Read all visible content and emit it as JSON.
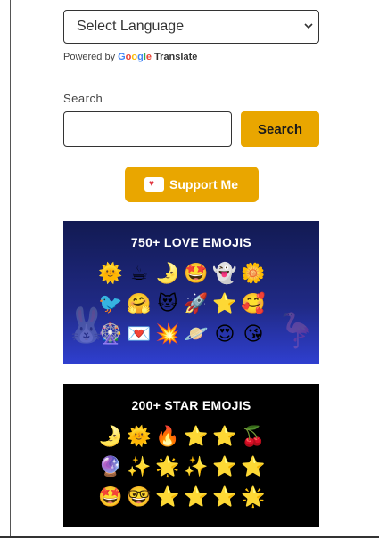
{
  "language_select": {
    "selected": "Select Language"
  },
  "powered_by": {
    "prefix": "Powered by",
    "brand": "Google",
    "product": "Translate"
  },
  "search": {
    "label": "Search",
    "button": "Search",
    "value": ""
  },
  "support": {
    "label": "Support Me",
    "icon": "ko-fi-cup-icon"
  },
  "banners": [
    {
      "title": "750+ LOVE EMOJIS",
      "emojis": [
        "🌞",
        "☕",
        "🌛",
        "🤩",
        "👻",
        "🌼",
        "🐦",
        "🤗",
        "😻",
        "🚀",
        "⭐",
        "🥰",
        "🎡",
        "💌",
        "💥",
        "🪐",
        "😍",
        "😘"
      ]
    },
    {
      "title": "200+ STAR EMOJIS",
      "emojis": [
        "🌛",
        "🌞",
        "🔥",
        "⭐",
        "⭐",
        "🍒",
        "🔮",
        "✨",
        "🌟",
        "✨",
        "⭐",
        "⭐",
        "🤩",
        "🤓",
        "⭐",
        "⭐",
        "⭐",
        "🌟"
      ]
    }
  ],
  "colors": {
    "accent": "#e9a600",
    "google_blue": "#4285f4",
    "google_red": "#ea4335",
    "google_yellow": "#fbbc05",
    "google_green": "#34a853"
  }
}
